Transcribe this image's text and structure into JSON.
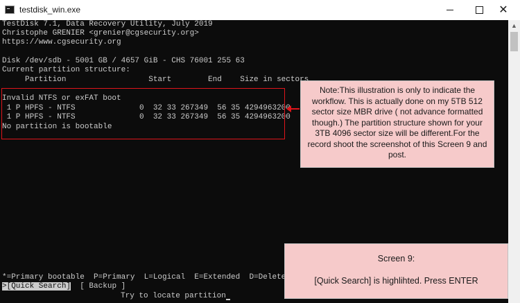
{
  "window": {
    "title": "testdisk_win.exe",
    "controls": {
      "minimize": "",
      "maximize": "",
      "close": "✕"
    }
  },
  "console": {
    "header": [
      "TestDisk 7.1, Data Recovery Utility, July 2019",
      "Christophe GRENIER <grenier@cgsecurity.org>",
      "https://www.cgsecurity.org"
    ],
    "disk_line": "Disk /dev/sdb - 5001 GB / 4657 GiB - CHS 76001 255 63",
    "structure_label": "Current partition structure:",
    "table_header": "     Partition                  Start        End    Size in sectors",
    "boot_error": "Invalid NTFS or exFAT boot",
    "partitions": [
      " 1 P HPFS - NTFS              0  32 33 267349  56 35 4294963200",
      " 1 P HPFS - NTFS              0  32 33 267349  56 35 4294963200"
    ],
    "no_bootable": "No partition is bootable",
    "legend": "*=Primary bootable  P=Primary  L=Logical  E=Extended  D=Deleted",
    "menu_selected": ">[Quick Search]",
    "menu_other": "  [ Backup ]",
    "hint": "Try to locate partition"
  },
  "annotations": {
    "note_workflow": "Note:This illustration is only to indicate the workflow. This is actually done on my 5TB 512 sector size MBR drive ( not advance formatted though.) The partition structure shown for your 3TB 4096 sector size will be different.For the record shoot the screenshot of this Screen 9 and post.",
    "screen_title": "Screen 9:",
    "screen_body": "[Quick Search] is highlihted. Press ENTER"
  },
  "colors": {
    "console_bg": "#0c0c0c",
    "console_text": "#cccccc",
    "highlight_box": "#e0151b",
    "note_bg": "#f6caca"
  }
}
